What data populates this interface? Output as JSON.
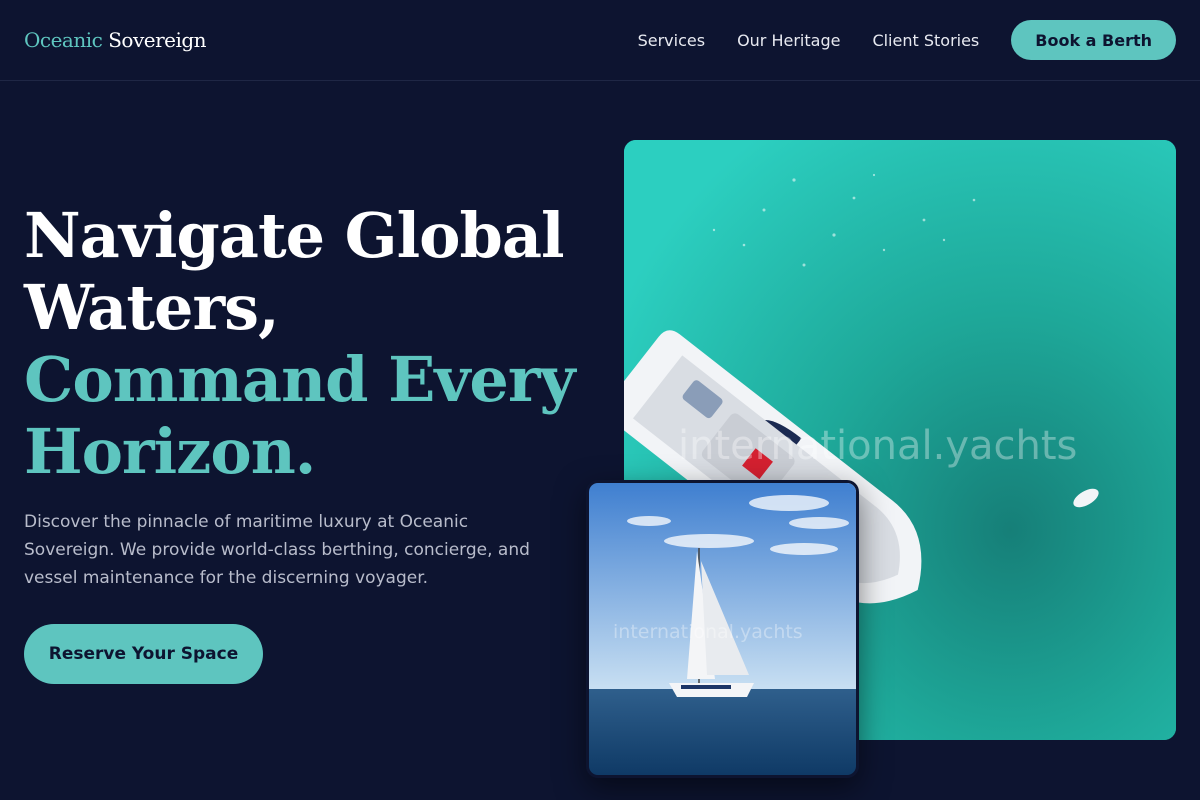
{
  "brand": {
    "part1": "Oceanic",
    "part2": "Sovereign"
  },
  "nav": {
    "items": [
      "Services",
      "Our Heritage",
      "Client Stories"
    ],
    "cta_label": "Book a Berth"
  },
  "hero": {
    "headline_line1": "Navigate Global",
    "headline_line2": "Waters,",
    "headline_line3": "Command Every",
    "headline_line4": "Horizon.",
    "description": "Discover the pinnacle of maritime luxury at Oceanic Sovereign. We provide world-class berthing, concierge, and vessel maintenance for the discerning voyager.",
    "cta_label": "Reserve Your Space"
  },
  "images": {
    "main_watermark": "international.yachts",
    "inset_watermark": "international.yachts"
  },
  "colors": {
    "background": "#0d1430",
    "accent": "#5ec5bf",
    "text": "#ffffff",
    "muted_text": "#b8bccb"
  },
  "icons": {
    "main_photo": "speedboat-aerial-photo",
    "inset_photo": "sailboat-photo"
  }
}
